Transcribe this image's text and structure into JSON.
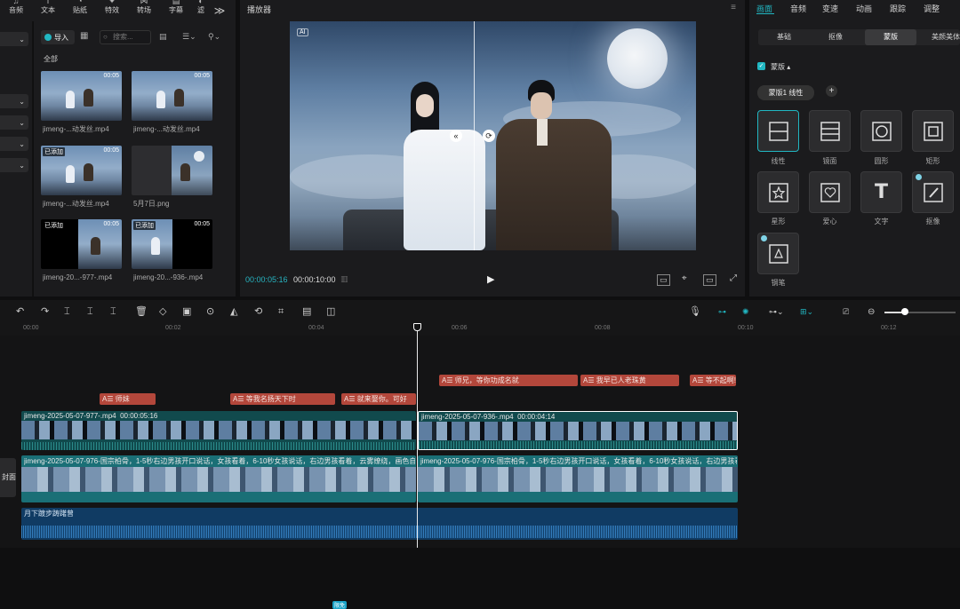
{
  "toolbar": {
    "items": [
      {
        "label": "音频",
        "icon": "audio-icon"
      },
      {
        "label": "文本",
        "icon": "text-icon"
      },
      {
        "label": "贴纸",
        "icon": "sticker-icon"
      },
      {
        "label": "特效",
        "icon": "effects-icon"
      },
      {
        "label": "转场",
        "icon": "transition-icon"
      },
      {
        "label": "字幕",
        "icon": "subtitle-icon"
      },
      {
        "label": "滤",
        "icon": "filter-icon"
      }
    ],
    "more": "≫"
  },
  "media": {
    "import_label": "导入",
    "search_placeholder": "搜索...",
    "all_label": "全部",
    "items": [
      {
        "name": "jimeng-...动发丝.mp4",
        "duration": "00:05",
        "badge": ""
      },
      {
        "name": "jimeng-...动发丝.mp4",
        "duration": "00:05",
        "badge": ""
      },
      {
        "name": "jimeng-...动发丝.mp4",
        "duration": "00:05",
        "badge": "已添加"
      },
      {
        "name": "5月7日.png",
        "duration": "",
        "badge": ""
      },
      {
        "name": "jimeng-20...-977-.mp4",
        "duration": "00:05",
        "badge": "已添加"
      },
      {
        "name": "jimeng-20...-936-.mp4",
        "duration": "00:05",
        "badge": "已添加"
      }
    ]
  },
  "player": {
    "title": "播放器",
    "ai_badge": "AI",
    "current_time": "00:00:05:16",
    "total_time": "00:00:10:00"
  },
  "inspector": {
    "tabs": [
      "画面",
      "音频",
      "变速",
      "动画",
      "跟踪",
      "调整"
    ],
    "active_tab": "画面",
    "subtabs": [
      "基础",
      "抠像",
      "蒙版",
      "美颜美体"
    ],
    "active_subtab": "蒙版",
    "section_label": "蒙版",
    "mask_pill": "蒙版1 线性",
    "masks": [
      {
        "label": "线性",
        "icon": "linear-mask-icon",
        "selected": true
      },
      {
        "label": "镜面",
        "icon": "mirror-mask-icon"
      },
      {
        "label": "圆形",
        "icon": "circle-mask-icon"
      },
      {
        "label": "矩形",
        "icon": "rect-mask-icon"
      },
      {
        "label": "星形",
        "icon": "star-mask-icon"
      },
      {
        "label": "爱心",
        "icon": "heart-mask-icon"
      },
      {
        "label": "文字",
        "icon": "text-mask-icon"
      },
      {
        "label": "抠像",
        "icon": "brush-mask-icon"
      },
      {
        "label": "钢笔",
        "icon": "pen-mask-icon"
      }
    ]
  },
  "timeline": {
    "ruler": [
      "00:00",
      "00:02",
      "00:04",
      "00:06",
      "00:08",
      "00:10",
      "00:12"
    ],
    "free_badge": "限免",
    "text_clips_row1": [
      "师兄，等你功成名就",
      "我早已人老珠黄",
      "等不起啊!"
    ],
    "text_clips_row2": [
      "师妹",
      "等我名扬天下时",
      "就来娶你。可好"
    ],
    "video_main": [
      {
        "name": "jimeng-2025-05-07-977-.mp4",
        "duration": "00:00:05:16"
      },
      {
        "name": "jimeng-2025-05-07-936-.mp4",
        "duration": "00:00:04:14"
      }
    ],
    "video_bg": [
      {
        "name": "jimeng-2025-05-07-976-国宗柏骨，1-5秒右边男孩开口说话，女孩看着，6-10秒女孩说话，右边男孩看着，云雾缭绕，画色自然，"
      },
      {
        "name": "jimeng-2025-05-07-976-国宗柏骨，1-5秒右边男孩开口说话，女孩看着，6-10秒女孩说话，右边男孩看着，云雾缭绕，画色自然"
      }
    ],
    "cover_label": "封面",
    "audio_name": "月下踱步踌躇曾"
  }
}
